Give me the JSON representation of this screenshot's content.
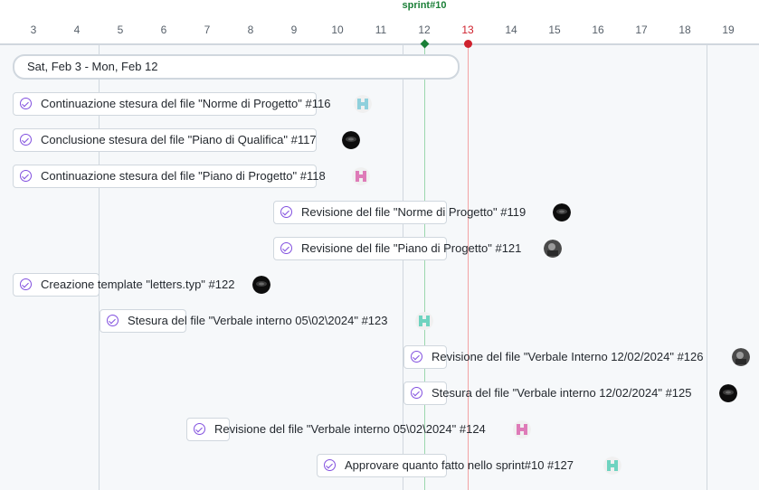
{
  "sprint_label": "sprint#10",
  "days": [
    "3",
    "4",
    "5",
    "6",
    "7",
    "8",
    "9",
    "10",
    "11",
    "12",
    "13",
    "14",
    "15",
    "16",
    "17",
    "18",
    "19"
  ],
  "today_day": "13",
  "date_range": "Sat, Feb 3 - Mon, Feb 12",
  "items": [
    {
      "title": "Continuazione stesura del file \"Norme di Progetto\" #116",
      "avatar": "teal-pixel-avatar"
    },
    {
      "title": "Conclusione stesura del file \"Piano di Qualifica\" #117",
      "avatar": "dark-photo-avatar"
    },
    {
      "title": "Continuazione stesura del file \"Piano di Progetto\" #118",
      "avatar": "pink-pixel-avatar"
    },
    {
      "title": "Revisione del file \"Norme di Progetto\" #119",
      "avatar": "dark-photo-avatar"
    },
    {
      "title": "Revisione del file \"Piano di Progetto\" #121",
      "avatar": "gray-photo-avatar"
    },
    {
      "title": "Creazione template \"letters.typ\" #122",
      "avatar": "dark-photo-avatar"
    },
    {
      "title": "Stesura del file \"Verbale interno 05\\02\\2024\" #123",
      "avatar": "green-pixel-avatar"
    },
    {
      "title": "Revisione del file \"Verbale Interno 12/02/2024\" #126",
      "avatar": "gray-photo-avatar"
    },
    {
      "title": "Stesura del file \"Verbale interno 12/02/2024\" #125",
      "avatar": "dark-photo-avatar"
    },
    {
      "title": "Revisione del file \"Verbale interno 05\\02\\2024\" #124",
      "avatar": "pink-pixel-avatar"
    },
    {
      "title": "Approvare quanto fatto nello sprint#10 #127",
      "avatar": "green-pixel-avatar"
    }
  ]
}
